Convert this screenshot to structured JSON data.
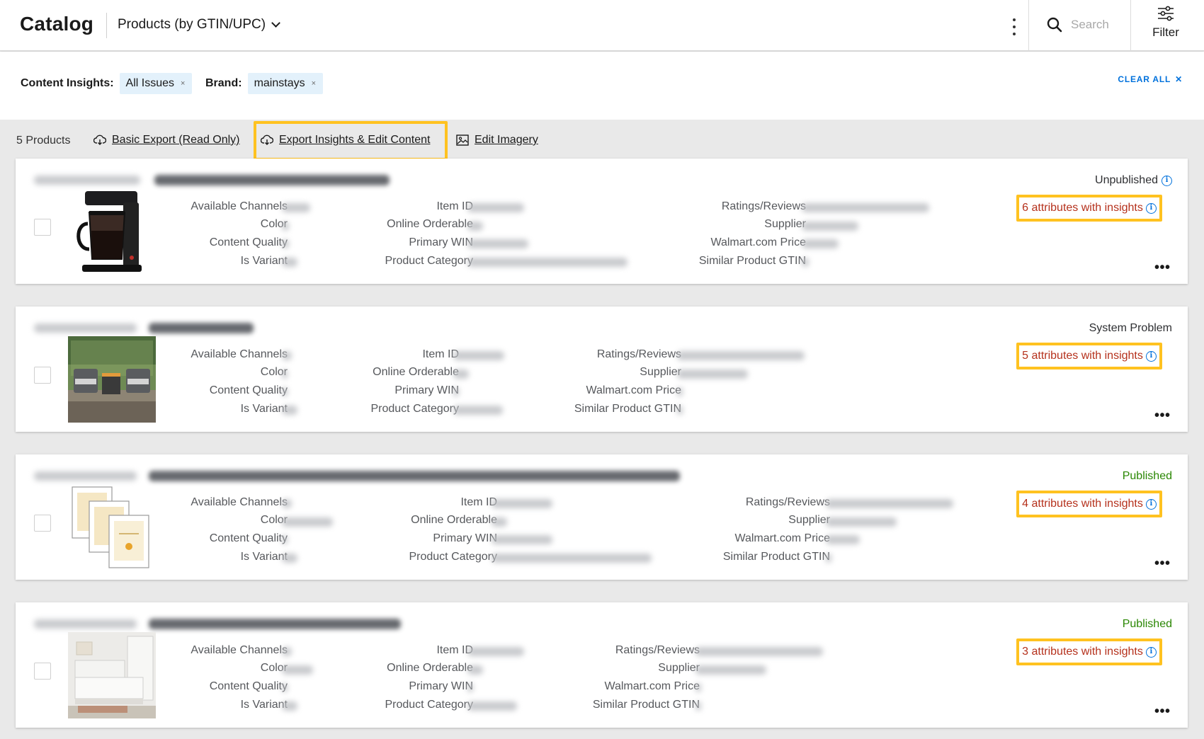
{
  "header": {
    "app_title": "Catalog",
    "dataset_selector": "Products (by GTIN/UPC)",
    "search_placeholder": "Search",
    "filter_label": "Filter"
  },
  "filters": {
    "content_insights_label": "Content Insights:",
    "content_insights_value": "All Issues",
    "brand_label": "Brand:",
    "brand_value": "mainstays",
    "remove_symbol": "×",
    "clear_all_label": "CLEAR ALL",
    "clear_all_symbol": "✕"
  },
  "toolbar": {
    "product_count": "5 Products",
    "basic_export": "Basic Export (Read Only)",
    "export_insights": "Export Insights & Edit Content",
    "edit_imagery": "Edit Imagery"
  },
  "field_labels": {
    "available_channels": "Available Channels",
    "color": "Color",
    "content_quality": "Content Quality",
    "is_variant": "Is Variant",
    "item_id": "Item ID",
    "online_orderable": "Online Orderable",
    "primary_win": "Primary WIN",
    "product_category": "Product Category",
    "ratings_reviews": "Ratings/Reviews",
    "supplier": "Supplier",
    "walmart_price": "Walmart.com Price",
    "similar_gtin": "Similar Product GTIN"
  },
  "products": [
    {
      "status": "Unpublished",
      "status_color": "#2e2f32",
      "insights": "6 attributes with insights",
      "image": "coffee-maker"
    },
    {
      "status": "System Problem",
      "status_color": "#2e2f32",
      "insights": "5 attributes with insights",
      "image": "patio-set"
    },
    {
      "status": "Published",
      "status_color": "#2a8703",
      "insights": "4 attributes with insights",
      "image": "picture-frames"
    },
    {
      "status": "Published",
      "status_color": "#2a8703",
      "insights": "3 attributes with insights",
      "image": "mattress-room"
    }
  ],
  "colors": {
    "accent_blue": "#0071dc",
    "highlight_yellow": "#ffc220",
    "insight_red": "#b5311c",
    "published_green": "#2a8703",
    "chip_bg": "#e3f1fb"
  }
}
